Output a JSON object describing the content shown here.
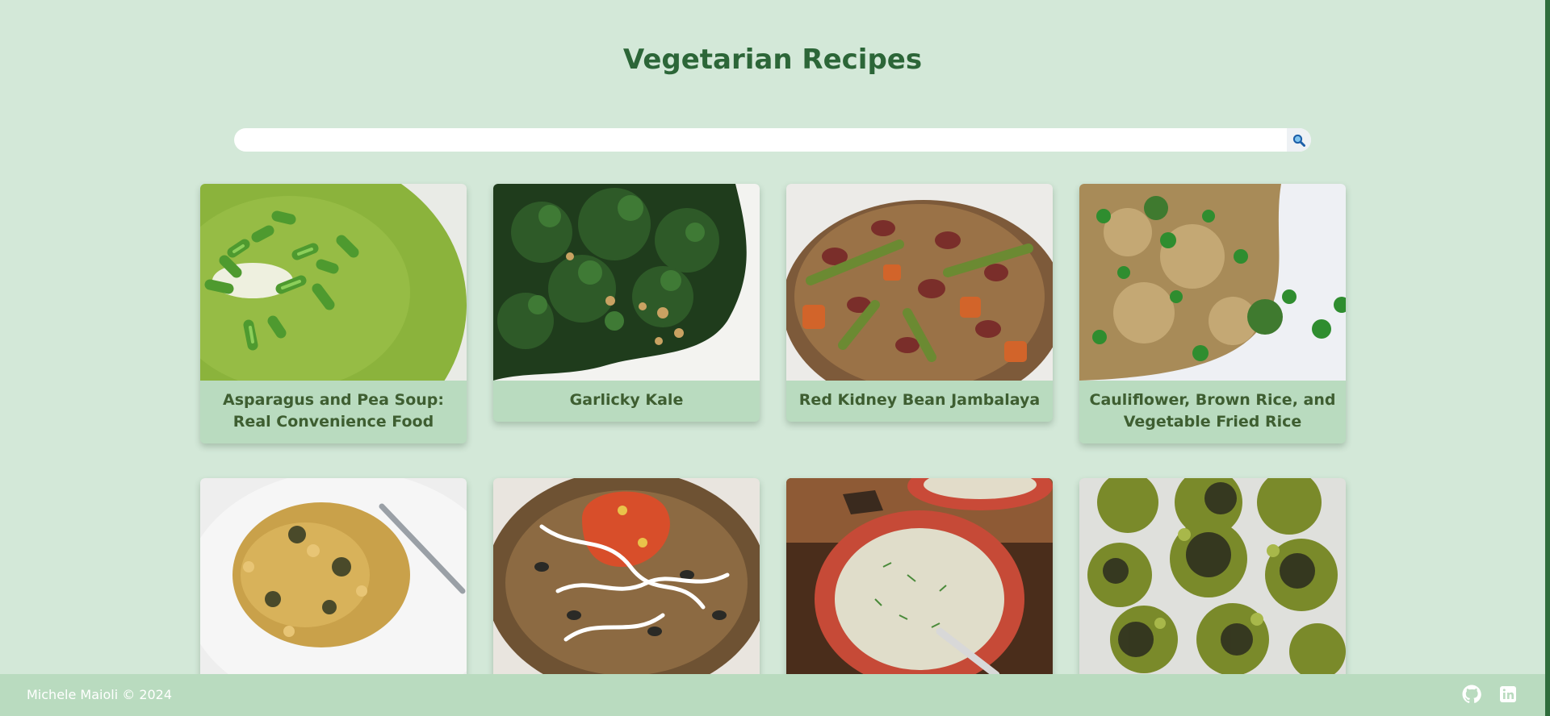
{
  "header": {
    "title": "Vegetarian Recipes"
  },
  "search": {
    "value": "",
    "placeholder": "",
    "icon": "search-icon"
  },
  "recipes": [
    {
      "title": "Asparagus and Pea Soup: Real Convenience Food"
    },
    {
      "title": "Garlicky Kale"
    },
    {
      "title": "Red Kidney Bean Jambalaya"
    },
    {
      "title": "Cauliflower, Brown Rice, and Vegetable Fried Rice"
    },
    {
      "title": ""
    },
    {
      "title": ""
    },
    {
      "title": ""
    },
    {
      "title": ""
    }
  ],
  "footer": {
    "copyright": "Michele Maioli © 2024",
    "icons": [
      "github-icon",
      "linkedin-icon"
    ]
  },
  "colors": {
    "background": "#d3e8d8",
    "card": "#b9dbbf",
    "title": "#2c6638",
    "card_title": "#3e5e31"
  }
}
